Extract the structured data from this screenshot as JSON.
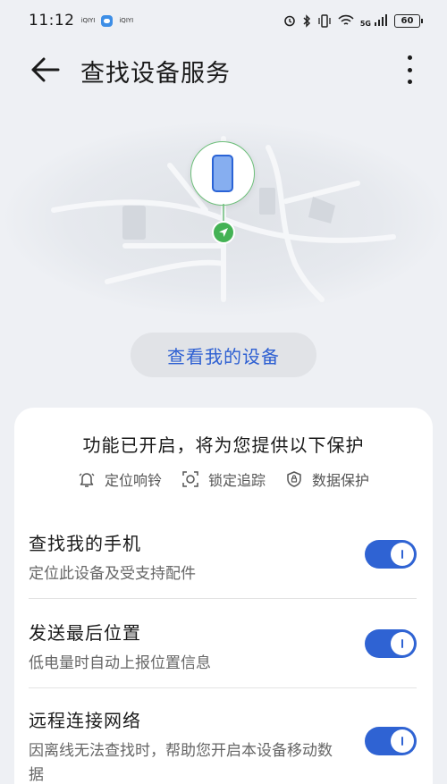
{
  "status_bar": {
    "time": "11:12",
    "carrier_label_1": "iQIYI",
    "carrier_label_2": "iQIYI",
    "network": "5G",
    "battery": "60",
    "icons": [
      "alarm-icon",
      "bluetooth-icon",
      "vibrate-icon",
      "wifi-icon",
      "signal-icon",
      "battery-icon"
    ]
  },
  "header": {
    "title": "查找设备服务"
  },
  "map": {
    "view_button_label": "查看我的设备"
  },
  "card": {
    "title": "功能已开启，将为您提供以下保护",
    "features": [
      {
        "label": "定位响铃",
        "icon": "bell-icon"
      },
      {
        "label": "锁定追踪",
        "icon": "lock-track-icon"
      },
      {
        "label": "数据保护",
        "icon": "shield-lock-icon"
      }
    ],
    "settings": [
      {
        "title": "查找我的手机",
        "description": "定位此设备及受支持配件",
        "enabled": true
      },
      {
        "title": "发送最后位置",
        "description": "低电量时自动上报位置信息",
        "enabled": true
      },
      {
        "title": "远程连接网络",
        "description": "因离线无法查找时，帮助您开启本设备移动数据",
        "enabled": true
      }
    ]
  },
  "colors": {
    "accent": "#2f63d3",
    "background": "#eef0f4",
    "pin_green": "#43b254"
  }
}
